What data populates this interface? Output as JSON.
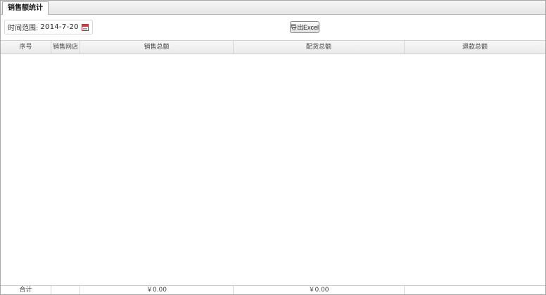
{
  "tab": {
    "label": "销售额统计"
  },
  "filter": {
    "label": "时间范围:",
    "date": "2014-7-20"
  },
  "toolbar": {
    "export_label": "导出Excel"
  },
  "grid": {
    "headers": [
      "序号",
      "销售网店",
      "销售总额",
      "配货总额",
      "退款总额"
    ],
    "footer": [
      "合计",
      "",
      "￥0.00",
      "￥0.00",
      ""
    ]
  }
}
